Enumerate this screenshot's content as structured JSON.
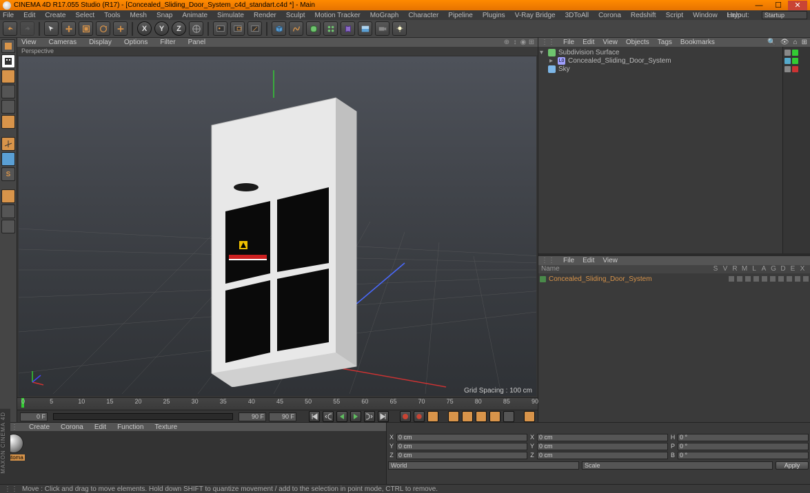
{
  "title": "CINEMA 4D R17.055 Studio (R17) - [Concealed_Sliding_Door_System_c4d_standart.c4d *] - Main",
  "layout_label": "Layout:",
  "layout_value": "Startup",
  "menubar": [
    "File",
    "Edit",
    "Create",
    "Select",
    "Tools",
    "Mesh",
    "Snap",
    "Animate",
    "Simulate",
    "Render",
    "Sculpt",
    "Motion Tracker",
    "MoGraph",
    "Character",
    "Pipeline",
    "Plugins",
    "V-Ray Bridge",
    "3DToAll",
    "Corona",
    "Redshift",
    "Script",
    "Window",
    "Help"
  ],
  "vp_menu": [
    "View",
    "Cameras",
    "Display",
    "Options",
    "Filter",
    "Panel"
  ],
  "vp_label": "Perspective",
  "grid_spacing": "Grid Spacing : 100 cm",
  "timeline": {
    "ticks": [
      "0",
      "5",
      "10",
      "15",
      "20",
      "25",
      "30",
      "35",
      "40",
      "45",
      "50",
      "55",
      "60",
      "65",
      "70",
      "75",
      "80",
      "85",
      "90"
    ],
    "frame_start": "0 F",
    "frame_end": "90 F",
    "frame_cur": "0 F",
    "frame_cur2": "90 F",
    "range_start": "0 F",
    "range_end": "90 F"
  },
  "om_menu": [
    "File",
    "Edit",
    "View",
    "Objects",
    "Tags",
    "Bookmarks"
  ],
  "om_tree": [
    {
      "name": "Subdivision Surface",
      "indent": 0,
      "expand": "-",
      "ic": "#6fc46f"
    },
    {
      "name": "Concealed_Sliding_Door_System",
      "indent": 1,
      "expand": "+",
      "ic": "#a0a0ff"
    },
    {
      "name": "Sky",
      "indent": 0,
      "expand": "",
      "ic": "#7db7e8"
    }
  ],
  "mm_menu": [
    "File",
    "Edit",
    "View"
  ],
  "mm_name_label": "Name",
  "mm_cols": [
    "S",
    "V",
    "R",
    "M",
    "L",
    "A",
    "G",
    "D",
    "E",
    "X"
  ],
  "mm_rows": [
    {
      "name": "Concealed_Sliding_Door_System"
    }
  ],
  "mat_menu": [
    "Create",
    "Corona",
    "Edit",
    "Function",
    "Texture"
  ],
  "mat_label": "Automa",
  "coords": {
    "head": [
      "",
      "",
      "",
      ""
    ],
    "x": "0 cm",
    "y": "0 cm",
    "z": "0 cm",
    "x2": "0 cm",
    "y2": "0 cm",
    "z2": "0 cm",
    "h": "0 °",
    "p": "0 °",
    "b": "0 °",
    "sel1": "World",
    "sel2": "Scale",
    "apply": "Apply"
  },
  "status": "Move : Click and drag to move elements. Hold down SHIFT to quantize movement / add to the selection in point mode, CTRL to remove.",
  "maxon": "MAXON CINEMA 4D"
}
